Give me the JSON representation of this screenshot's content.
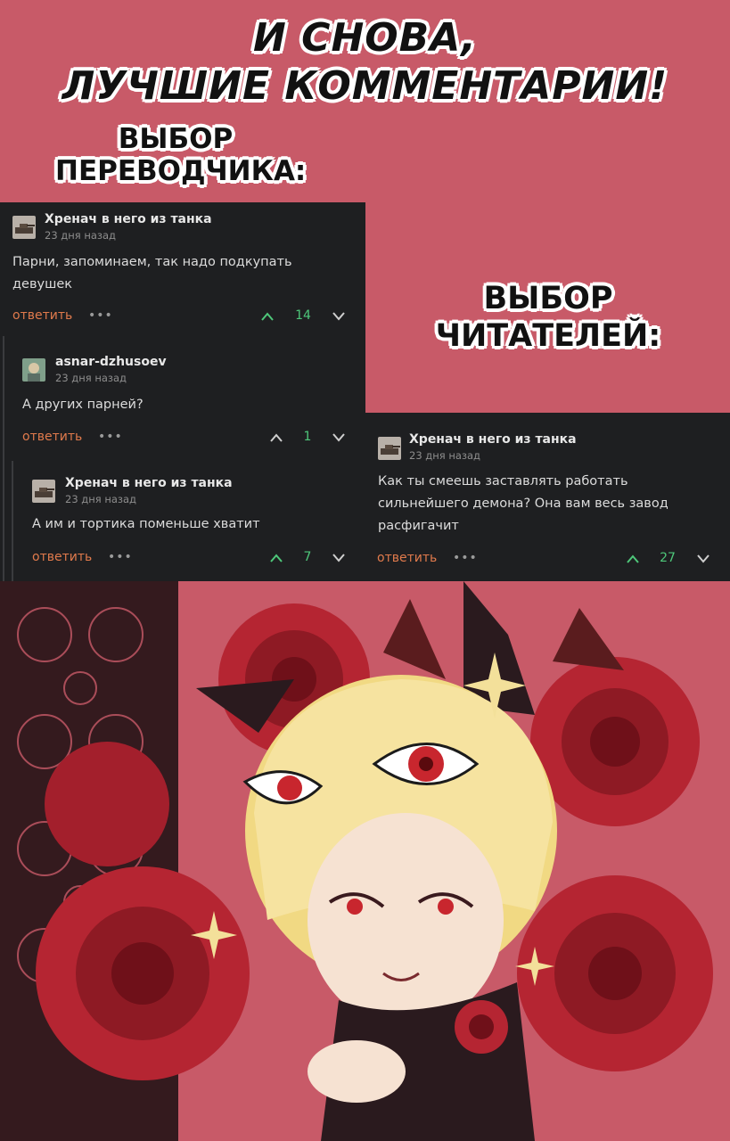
{
  "title": {
    "line1": "И СНОВА,",
    "line2": "ЛУЧШИЕ КОММЕНТАРИИ!"
  },
  "labels": {
    "translator_line1": "ВЫБОР",
    "translator_line2": "ПЕРЕВОДЧИКА:",
    "readers_line1": "ВЫБОР",
    "readers_line2": "ЧИТАТЕЛЕЙ:"
  },
  "comments": [
    {
      "author": "Хренач в него из танка",
      "time": "23 дня назад",
      "text_line1": "Парни, запоминаем, так надо подкупать",
      "text_line2": "девушек",
      "reply": "ответить",
      "dots": "•••",
      "votes": "14",
      "avatar_icon": "tank-avatar-icon"
    },
    {
      "author": "asnar-dzhusoev",
      "time": "23 дня назад",
      "text_line1": "А других парней?",
      "reply": "ответить",
      "dots": "•••",
      "votes": "1",
      "avatar_icon": "character-avatar-icon"
    },
    {
      "author": "Хренач в него из танка",
      "time": "23 дня назад",
      "text_line1": "А им и тортика поменьше хватит",
      "reply": "ответить",
      "dots": "•••",
      "votes": "7",
      "avatar_icon": "tank-avatar-icon"
    },
    {
      "author": "Хренач в него из танка",
      "time": "23 дня назад",
      "text_line1": "Как ты смеешь заставлять работать",
      "text_line2": "сильнейшего демона? Она вам весь завод",
      "text_line3": "расфигачит",
      "reply": "ответить",
      "dots": "•••",
      "votes": "27",
      "avatar_icon": "tank-avatar-icon"
    }
  ],
  "colors": {
    "background": "#c85a68",
    "panel": "#1e1f21",
    "reply": "#e07a4c",
    "vote_positive": "#4ec77a",
    "vote_neutral": "#e4e4e4"
  }
}
